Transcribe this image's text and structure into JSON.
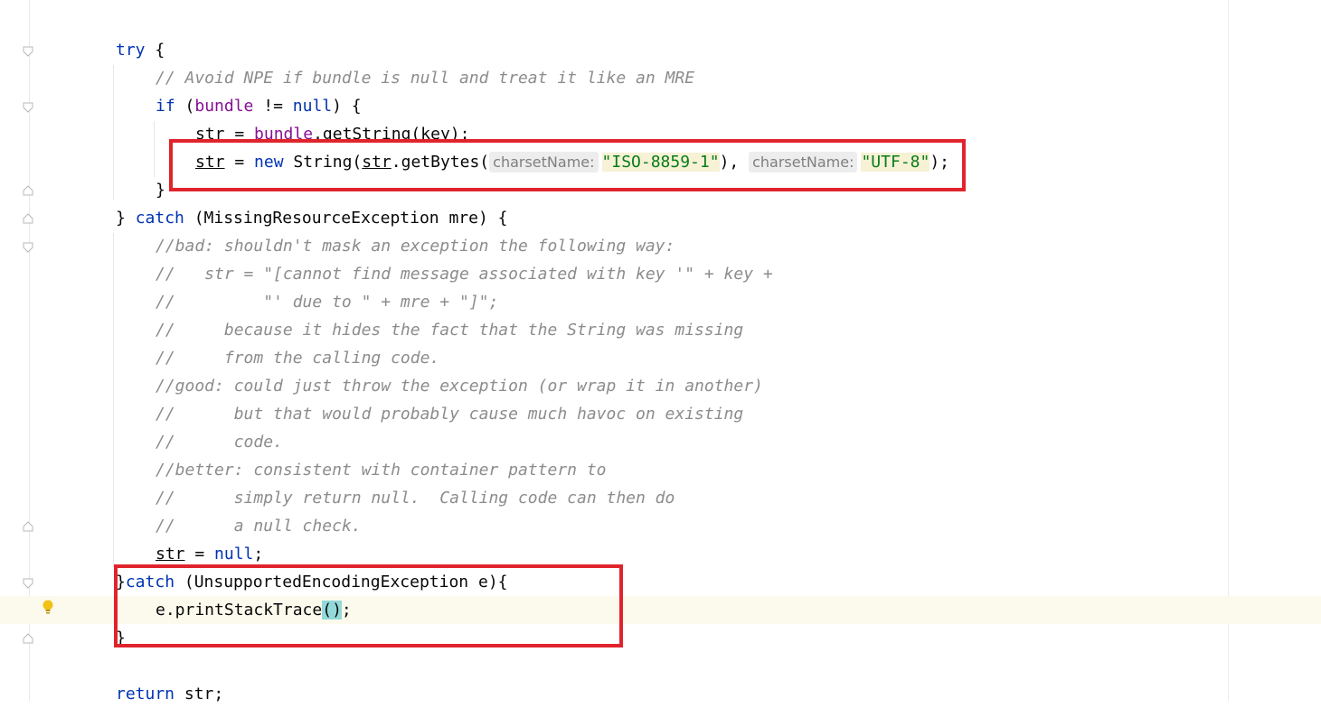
{
  "editor": {
    "lines": {
      "l_try_kw": "try",
      "l_try_rest": " {",
      "l_c1": "// Avoid NPE if bundle is null and treat it like an MRE",
      "l_if_kw": "if",
      "l_if_a": " (",
      "l_if_bundle": "bundle",
      "l_if_b": " != ",
      "l_if_null": "null",
      "l_if_c": ") {",
      "l_gs_a": "str = ",
      "l_gs_bundle": "bundle",
      "l_gs_b": ".getString(key);",
      "l_ns_str": "str",
      "l_ns_a": " = ",
      "l_ns_new": "new",
      "l_ns_b": " String(",
      "l_ns_str2": "str",
      "l_ns_c": ".getBytes(",
      "l_ns_hint1": "charsetName:",
      "l_ns_s1": "\"ISO-8859-1\"",
      "l_ns_d": "),",
      "l_ns_hint2": "charsetName:",
      "l_ns_s2": "\"UTF-8\"",
      "l_ns_e": ");",
      "l_close1": "}",
      "l_catch1_a": "} ",
      "l_catch1_kw": "catch",
      "l_catch1_b": " (MissingResourceException mre) {",
      "l_c2": "//bad: shouldn't mask an exception the following way:",
      "l_c3": "//   str = \"[cannot find message associated with key '\" + key +",
      "l_c4": "//         \"' due to \" + mre + \"]\";",
      "l_c5": "//     because it hides the fact that the String was missing",
      "l_c6": "//     from the calling code.",
      "l_c7": "//good: could just throw the exception (or wrap it in another)",
      "l_c8": "//      but that would probably cause much havoc on existing",
      "l_c9": "//      code.",
      "l_c10": "//better: consistent with container pattern to",
      "l_c11": "//      simply return null.  Calling code can then do",
      "l_c12": "//      a null check.",
      "l_sn_str": "str",
      "l_sn_a": " = ",
      "l_sn_null": "null",
      "l_sn_b": ";",
      "l_catch2_a": "}",
      "l_catch2_kw": "catch",
      "l_catch2_b": " (UnsupportedEncodingException e){",
      "l_pst_a": "e.printStackTrace",
      "l_pst_paren": "()",
      "l_pst_b": ";",
      "l_close2": "}",
      "l_ret_kw": "return",
      "l_ret_a": " str;"
    }
  },
  "colors": {
    "keyword": "#0033b3",
    "field": "#871094",
    "comment": "#8c8c8c",
    "string": "#067d17",
    "annotation_box": "#e0242c",
    "caret_line": "#fcfaed"
  }
}
